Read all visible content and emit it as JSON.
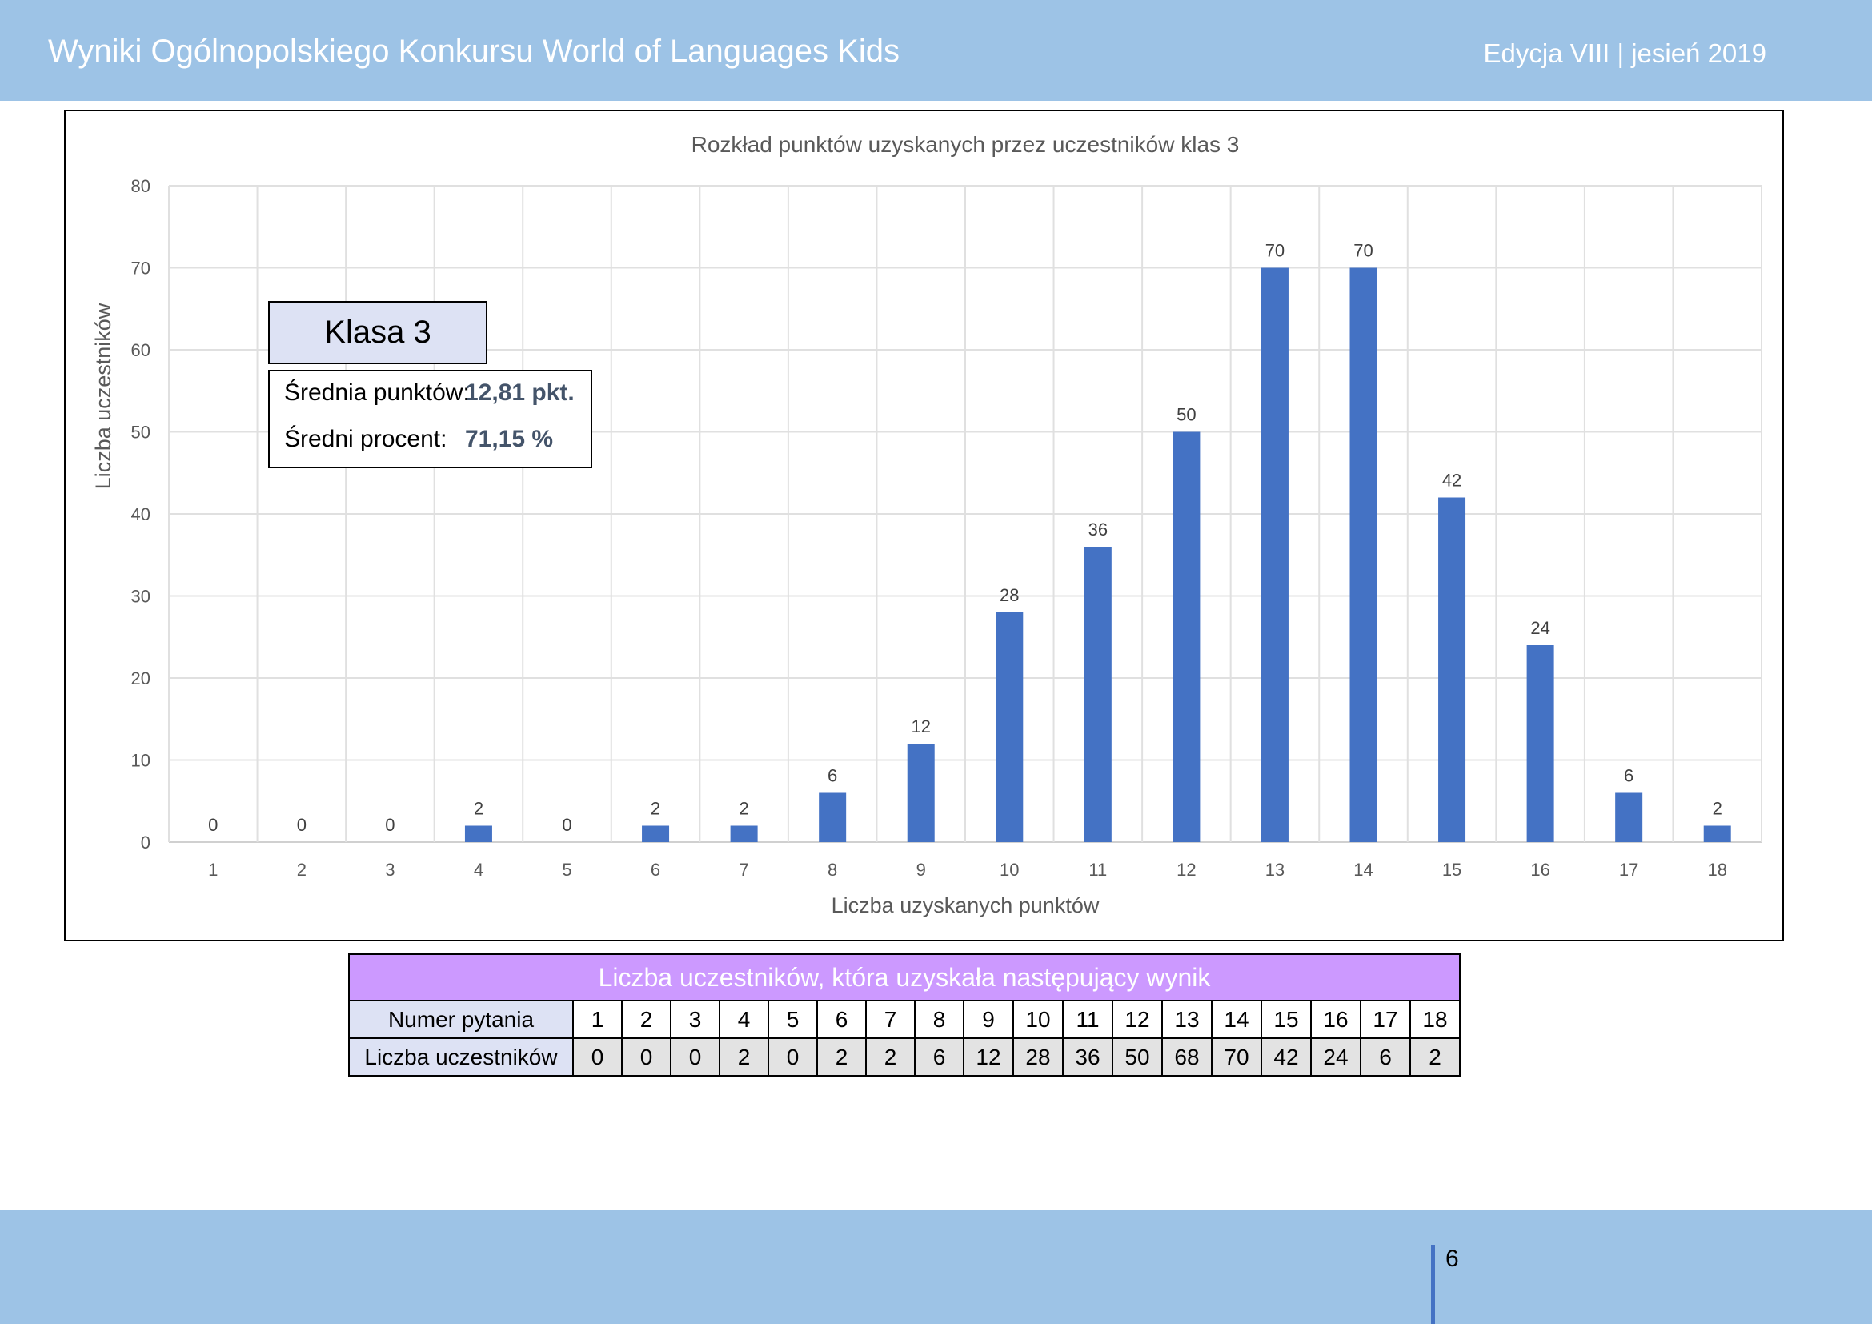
{
  "header": {
    "title": "Wyniki Ogólnopolskiego Konkursu World of Languages Kids",
    "edition": "Edycja VIII  |   jesień 2019"
  },
  "summary": {
    "class_label": "Klasa 3",
    "avg_points_label": "Średnia punktów:",
    "avg_points_value": "12,81 pkt.",
    "avg_percent_label": "Średni procent:",
    "avg_percent_value": "71,15 %"
  },
  "table": {
    "caption": "Liczba uczestników, która uzyskała następujący wynik",
    "row1_label": "Numer pytania",
    "row2_label": "Liczba uczestników",
    "questions": [
      "1",
      "2",
      "3",
      "4",
      "5",
      "6",
      "7",
      "8",
      "9",
      "10",
      "11",
      "12",
      "13",
      "14",
      "15",
      "16",
      "17",
      "18"
    ],
    "counts": [
      "0",
      "0",
      "0",
      "2",
      "0",
      "2",
      "2",
      "6",
      "12",
      "28",
      "36",
      "50",
      "68",
      "70",
      "42",
      "24",
      "6",
      "2"
    ]
  },
  "footer": {
    "page_number": "6"
  },
  "colors": {
    "header_band": "#9DC3E6",
    "bar": "#4472C4",
    "table_caption": "#CC99FF",
    "label_cell": "#DDE2F4",
    "value_cell": "#E3E3E3"
  },
  "chart_data": {
    "type": "bar",
    "title": "Rozkład punktów uzyskanych przez uczestników klas 3",
    "xlabel": "Liczba uzyskanych punktów",
    "ylabel": "Liczba uczestników",
    "categories": [
      "1",
      "2",
      "3",
      "4",
      "5",
      "6",
      "7",
      "8",
      "9",
      "10",
      "11",
      "12",
      "13",
      "14",
      "15",
      "16",
      "17",
      "18"
    ],
    "values": [
      0,
      0,
      0,
      2,
      0,
      2,
      2,
      6,
      12,
      28,
      36,
      50,
      70,
      70,
      42,
      24,
      6,
      2
    ],
    "ylim": [
      0,
      80
    ],
    "yticks": [
      0,
      10,
      20,
      30,
      40,
      50,
      60,
      70,
      80
    ],
    "grid": true,
    "data_labels": true
  }
}
